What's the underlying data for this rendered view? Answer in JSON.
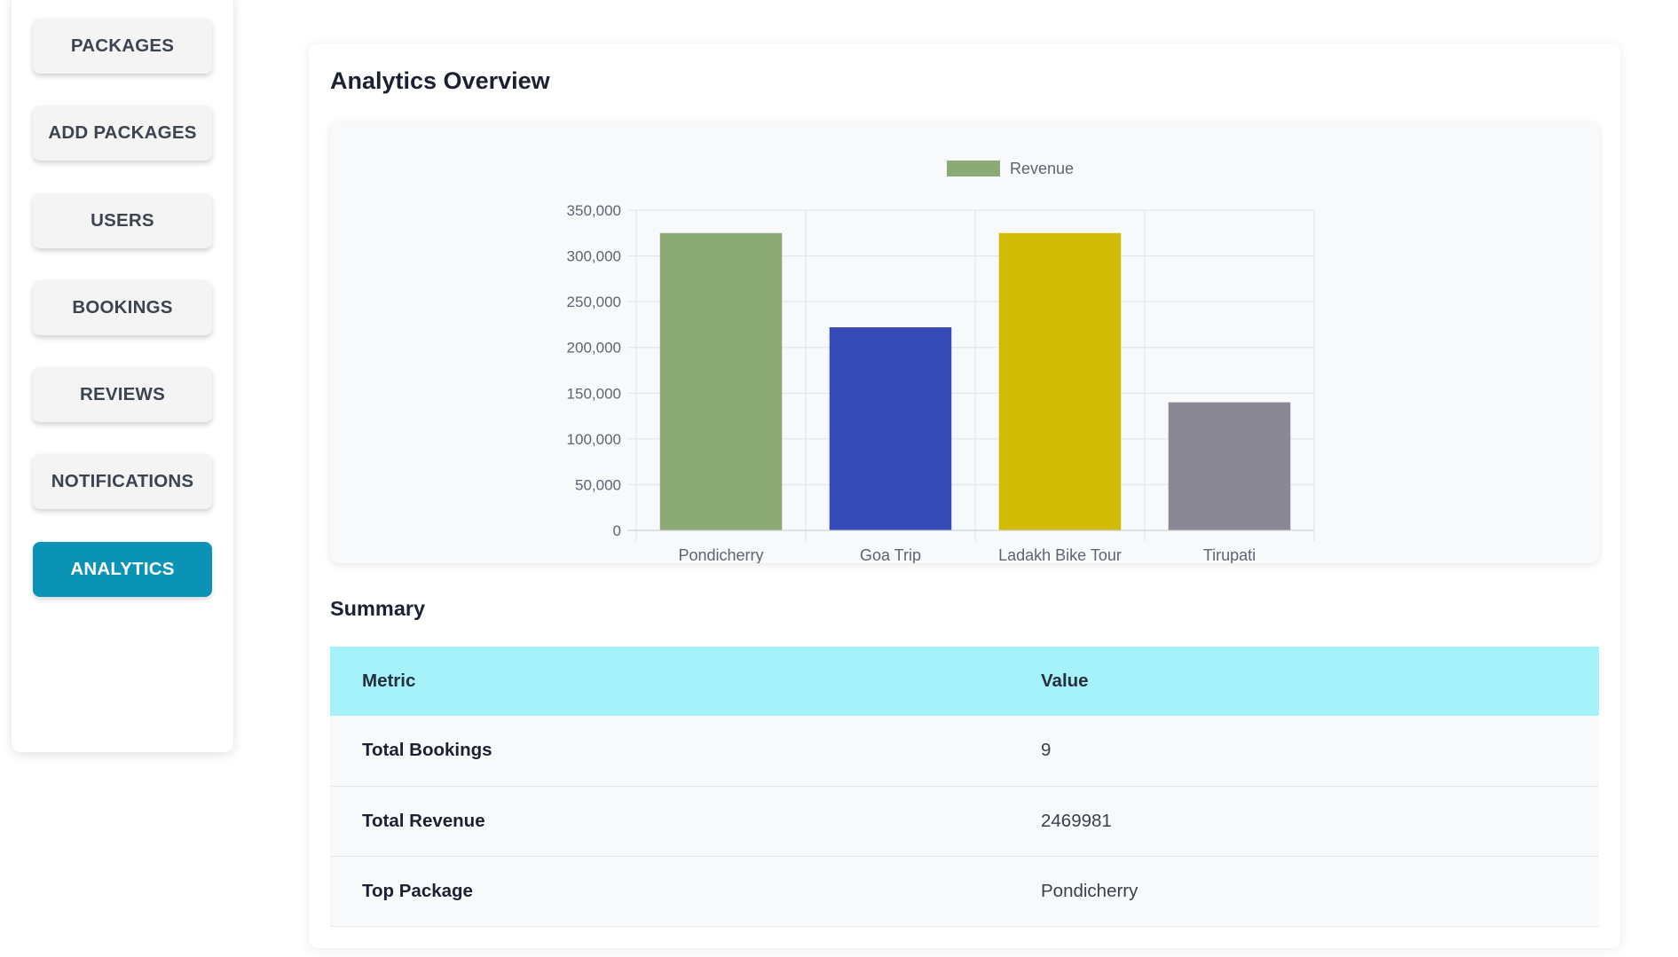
{
  "sidebar": {
    "items": [
      {
        "label": "PACKAGES",
        "active": false
      },
      {
        "label": "ADD PACKAGES",
        "active": false
      },
      {
        "label": "USERS",
        "active": false
      },
      {
        "label": "BOOKINGS",
        "active": false
      },
      {
        "label": "REVIEWS",
        "active": false
      },
      {
        "label": "NOTIFICATIONS",
        "active": false
      },
      {
        "label": "ANALYTICS",
        "active": true
      }
    ],
    "active_color": "#0b93b6"
  },
  "main": {
    "title": "Analytics Overview",
    "summary_title": "Summary"
  },
  "chart_data": {
    "type": "bar",
    "categories": [
      "Pondicherry",
      "Goa Trip",
      "Ladakh Bike Tour",
      "Tirupati"
    ],
    "series": [
      {
        "name": "Revenue",
        "values": [
          325000,
          222000,
          325000,
          140000
        ]
      }
    ],
    "bar_colors": [
      "#8caa75",
      "#374bb7",
      "#d1bb05",
      "#8a8894"
    ],
    "legend": {
      "label": "Revenue",
      "position": "top-center",
      "color": "#8caa75"
    },
    "ylim": [
      0,
      350000
    ],
    "yticks": [
      0,
      50000,
      100000,
      150000,
      200000,
      250000,
      300000,
      350000
    ],
    "ytick_labels": [
      "0",
      "50,000",
      "100,000",
      "150,000",
      "200,000",
      "250,000",
      "300,000",
      "350,000"
    ],
    "grid": true,
    "title": "",
    "xlabel": "",
    "ylabel": ""
  },
  "summary": {
    "headers": {
      "metric": "Metric",
      "value": "Value"
    },
    "rows": [
      {
        "metric": "Total Bookings",
        "value": "9"
      },
      {
        "metric": "Total Revenue",
        "value": "2469981"
      },
      {
        "metric": "Top Package",
        "value": "Pondicherry"
      }
    ]
  }
}
